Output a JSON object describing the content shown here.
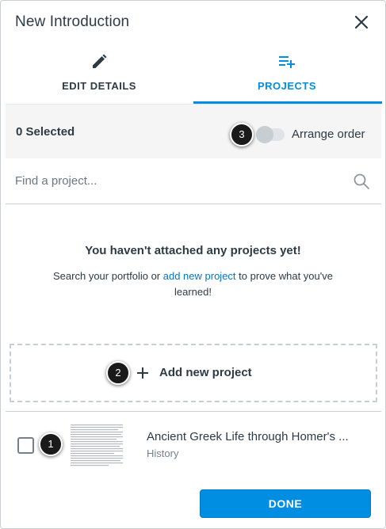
{
  "header": {
    "title": "New Introduction",
    "close_icon": "close-icon"
  },
  "tabs": [
    {
      "label": "EDIT DETAILS",
      "icon": "pencil-icon",
      "active": false
    },
    {
      "label": "PROJECTS",
      "icon": "playlist-add-icon",
      "active": true
    }
  ],
  "selection": {
    "count_label": "0 Selected",
    "arrange_label": "Arrange order",
    "arrange_enabled": false
  },
  "search": {
    "placeholder": "Find a project...",
    "value": "",
    "icon": "search-icon"
  },
  "empty_state": {
    "title": "You haven't attached any projects yet!",
    "desc_before": "Search your portfolio or ",
    "desc_link": "add new project",
    "desc_after": " to prove what you've learned!"
  },
  "add_project": {
    "label": "Add new project",
    "icon": "plus-icon"
  },
  "project": {
    "title": "Ancient Greek Life through Homer's ...",
    "subject": "History",
    "checked": false
  },
  "footer": {
    "done_label": "DONE"
  },
  "callouts": {
    "one": "1",
    "two": "2",
    "three": "3"
  },
  "colors": {
    "accent": "#008ee2",
    "link": "#0077cc",
    "text": "#2d3b45",
    "muted": "#73818c"
  }
}
